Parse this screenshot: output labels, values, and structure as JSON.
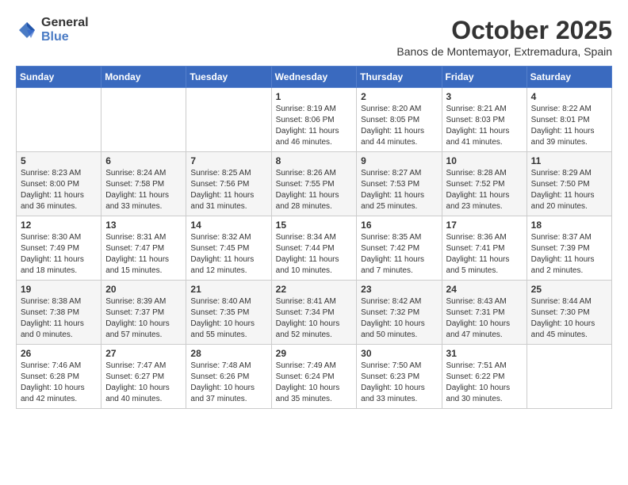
{
  "header": {
    "logo_general": "General",
    "logo_blue": "Blue",
    "month": "October 2025",
    "location": "Banos de Montemayor, Extremadura, Spain"
  },
  "weekdays": [
    "Sunday",
    "Monday",
    "Tuesday",
    "Wednesday",
    "Thursday",
    "Friday",
    "Saturday"
  ],
  "weeks": [
    [
      {
        "day": "",
        "info": ""
      },
      {
        "day": "",
        "info": ""
      },
      {
        "day": "",
        "info": ""
      },
      {
        "day": "1",
        "info": "Sunrise: 8:19 AM\nSunset: 8:06 PM\nDaylight: 11 hours\nand 46 minutes."
      },
      {
        "day": "2",
        "info": "Sunrise: 8:20 AM\nSunset: 8:05 PM\nDaylight: 11 hours\nand 44 minutes."
      },
      {
        "day": "3",
        "info": "Sunrise: 8:21 AM\nSunset: 8:03 PM\nDaylight: 11 hours\nand 41 minutes."
      },
      {
        "day": "4",
        "info": "Sunrise: 8:22 AM\nSunset: 8:01 PM\nDaylight: 11 hours\nand 39 minutes."
      }
    ],
    [
      {
        "day": "5",
        "info": "Sunrise: 8:23 AM\nSunset: 8:00 PM\nDaylight: 11 hours\nand 36 minutes."
      },
      {
        "day": "6",
        "info": "Sunrise: 8:24 AM\nSunset: 7:58 PM\nDaylight: 11 hours\nand 33 minutes."
      },
      {
        "day": "7",
        "info": "Sunrise: 8:25 AM\nSunset: 7:56 PM\nDaylight: 11 hours\nand 31 minutes."
      },
      {
        "day": "8",
        "info": "Sunrise: 8:26 AM\nSunset: 7:55 PM\nDaylight: 11 hours\nand 28 minutes."
      },
      {
        "day": "9",
        "info": "Sunrise: 8:27 AM\nSunset: 7:53 PM\nDaylight: 11 hours\nand 25 minutes."
      },
      {
        "day": "10",
        "info": "Sunrise: 8:28 AM\nSunset: 7:52 PM\nDaylight: 11 hours\nand 23 minutes."
      },
      {
        "day": "11",
        "info": "Sunrise: 8:29 AM\nSunset: 7:50 PM\nDaylight: 11 hours\nand 20 minutes."
      }
    ],
    [
      {
        "day": "12",
        "info": "Sunrise: 8:30 AM\nSunset: 7:49 PM\nDaylight: 11 hours\nand 18 minutes."
      },
      {
        "day": "13",
        "info": "Sunrise: 8:31 AM\nSunset: 7:47 PM\nDaylight: 11 hours\nand 15 minutes."
      },
      {
        "day": "14",
        "info": "Sunrise: 8:32 AM\nSunset: 7:45 PM\nDaylight: 11 hours\nand 12 minutes."
      },
      {
        "day": "15",
        "info": "Sunrise: 8:34 AM\nSunset: 7:44 PM\nDaylight: 11 hours\nand 10 minutes."
      },
      {
        "day": "16",
        "info": "Sunrise: 8:35 AM\nSunset: 7:42 PM\nDaylight: 11 hours\nand 7 minutes."
      },
      {
        "day": "17",
        "info": "Sunrise: 8:36 AM\nSunset: 7:41 PM\nDaylight: 11 hours\nand 5 minutes."
      },
      {
        "day": "18",
        "info": "Sunrise: 8:37 AM\nSunset: 7:39 PM\nDaylight: 11 hours\nand 2 minutes."
      }
    ],
    [
      {
        "day": "19",
        "info": "Sunrise: 8:38 AM\nSunset: 7:38 PM\nDaylight: 11 hours\nand 0 minutes."
      },
      {
        "day": "20",
        "info": "Sunrise: 8:39 AM\nSunset: 7:37 PM\nDaylight: 10 hours\nand 57 minutes."
      },
      {
        "day": "21",
        "info": "Sunrise: 8:40 AM\nSunset: 7:35 PM\nDaylight: 10 hours\nand 55 minutes."
      },
      {
        "day": "22",
        "info": "Sunrise: 8:41 AM\nSunset: 7:34 PM\nDaylight: 10 hours\nand 52 minutes."
      },
      {
        "day": "23",
        "info": "Sunrise: 8:42 AM\nSunset: 7:32 PM\nDaylight: 10 hours\nand 50 minutes."
      },
      {
        "day": "24",
        "info": "Sunrise: 8:43 AM\nSunset: 7:31 PM\nDaylight: 10 hours\nand 47 minutes."
      },
      {
        "day": "25",
        "info": "Sunrise: 8:44 AM\nSunset: 7:30 PM\nDaylight: 10 hours\nand 45 minutes."
      }
    ],
    [
      {
        "day": "26",
        "info": "Sunrise: 7:46 AM\nSunset: 6:28 PM\nDaylight: 10 hours\nand 42 minutes."
      },
      {
        "day": "27",
        "info": "Sunrise: 7:47 AM\nSunset: 6:27 PM\nDaylight: 10 hours\nand 40 minutes."
      },
      {
        "day": "28",
        "info": "Sunrise: 7:48 AM\nSunset: 6:26 PM\nDaylight: 10 hours\nand 37 minutes."
      },
      {
        "day": "29",
        "info": "Sunrise: 7:49 AM\nSunset: 6:24 PM\nDaylight: 10 hours\nand 35 minutes."
      },
      {
        "day": "30",
        "info": "Sunrise: 7:50 AM\nSunset: 6:23 PM\nDaylight: 10 hours\nand 33 minutes."
      },
      {
        "day": "31",
        "info": "Sunrise: 7:51 AM\nSunset: 6:22 PM\nDaylight: 10 hours\nand 30 minutes."
      },
      {
        "day": "",
        "info": ""
      }
    ]
  ]
}
